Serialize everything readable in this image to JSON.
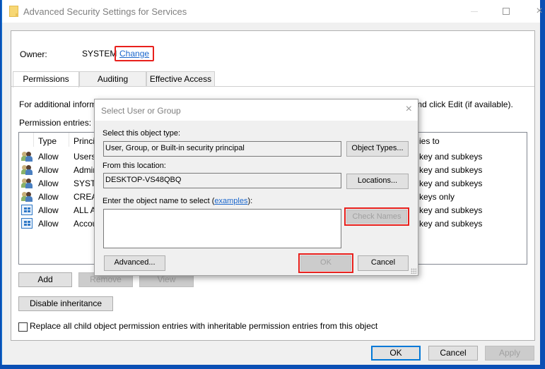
{
  "window": {
    "title": "Advanced Security Settings for Services",
    "icon": "folder-icon",
    "controls": {
      "minimize": "minimize-icon",
      "maximize": "maximize-icon",
      "close": "×"
    }
  },
  "owner": {
    "label": "Owner:",
    "value": "SYSTEM",
    "change_link": "Change"
  },
  "tabs": [
    {
      "label": "Permissions",
      "active": true
    },
    {
      "label": "Auditing",
      "active": false
    },
    {
      "label": "Effective Access",
      "active": false
    }
  ],
  "permissions": {
    "info_text_left": "For additional inform",
    "info_text_right": "nd click Edit (if available).",
    "entries_label": "Permission entries:",
    "columns": [
      "Type",
      "Princip",
      "ies to"
    ],
    "rows": [
      {
        "icon": "users-icon",
        "type": "Allow",
        "principal": "Users (",
        "applies": "key and subkeys"
      },
      {
        "icon": "users-icon",
        "type": "Allow",
        "principal": "Admin",
        "applies": "key and subkeys"
      },
      {
        "icon": "users-icon",
        "type": "Allow",
        "principal": "SYSTEI",
        "applies": "key and subkeys"
      },
      {
        "icon": "users-icon",
        "type": "Allow",
        "principal": "CREAT",
        "applies": "keys only"
      },
      {
        "icon": "app-package-icon",
        "type": "Allow",
        "principal": "ALL AI",
        "applies": "key and subkeys"
      },
      {
        "icon": "app-package-icon",
        "type": "Allow",
        "principal": "Accou",
        "applies": "key and subkeys"
      }
    ],
    "buttons": {
      "add": "Add",
      "remove": "Remove",
      "view": "View",
      "disable_inheritance": "Disable inheritance"
    },
    "replace_checkbox": {
      "label": "Replace all child object permission entries with inheritable permission entries from this object",
      "checked": false
    }
  },
  "footer": {
    "ok": "OK",
    "cancel": "Cancel",
    "apply": "Apply"
  },
  "select_dialog": {
    "title": "Select User or Group",
    "close": "×",
    "object_type_label": "Select this object type:",
    "object_type_value": "User, Group, or Built-in security principal",
    "object_types_button": "Object Types...",
    "location_label": "From this location:",
    "location_value": "DESKTOP-VS48QBQ",
    "locations_button": "Locations...",
    "enter_name_label_prefix": "Enter the object name to select (",
    "enter_name_link": "examples",
    "enter_name_label_suffix": "):",
    "enter_name_value": "",
    "check_names_button": "Check Names",
    "advanced_button": "Advanced...",
    "ok_button": "OK",
    "cancel_button": "Cancel"
  },
  "highlight_color": "#e8201c",
  "link_color": "#1a66cc"
}
